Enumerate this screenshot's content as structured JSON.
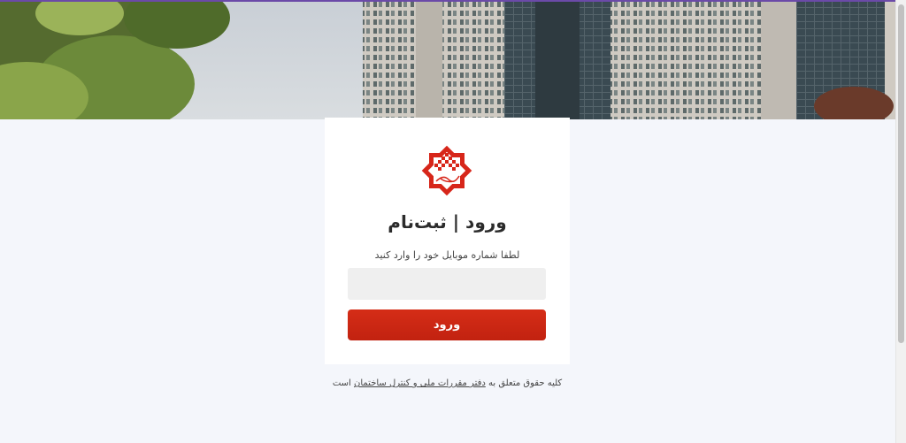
{
  "login": {
    "title": "ورود | ثبت‌نام",
    "subtitle": "لطفا شماره موبایل خود را وارد کنید",
    "phone_value": "",
    "button_label": "ورود"
  },
  "footer": {
    "prefix": "کلیه حقوق متعلق به",
    "link_text": "دفتر مقررات ملی و کنترل ساختمان",
    "suffix": "است"
  },
  "colors": {
    "accent": "#cc2815",
    "page_background": "#f4f6fb",
    "top_line": "#6b4aa8"
  },
  "icons": {
    "logo": "octagram-emblem-icon"
  }
}
